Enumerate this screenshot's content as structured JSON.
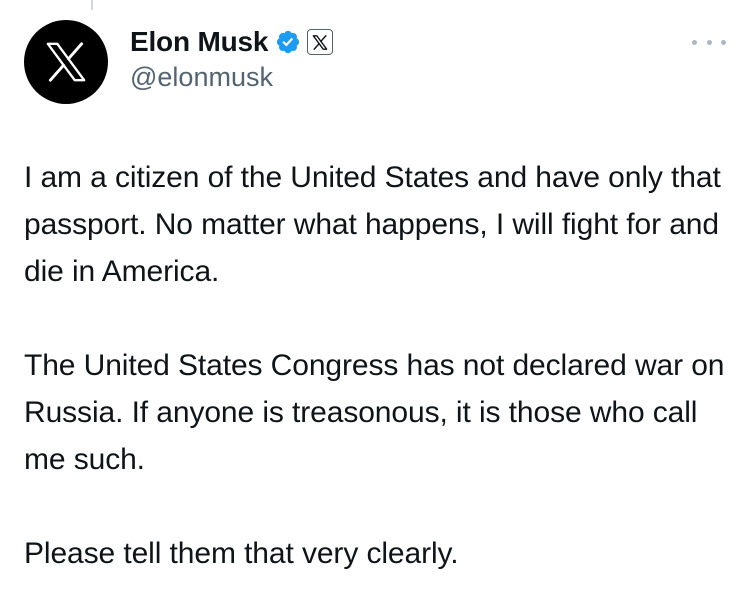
{
  "author": {
    "display_name": "Elon Musk",
    "handle": "@elonmusk",
    "avatar_icon": "x-logo-icon",
    "verified_badge_color": "#1d9bf0",
    "affiliate_badge_icon": "x-logo-icon"
  },
  "tweet": {
    "paragraphs": [
      "I am a citizen of the United States and have only that passport. No matter what happens, I will fight for and die in America.",
      "The United States Congress has not declared war on Russia. If anyone is treasonous, it is those who call me such.",
      "Please tell them that very clearly."
    ]
  },
  "more_icon": "more-horizontal-icon"
}
